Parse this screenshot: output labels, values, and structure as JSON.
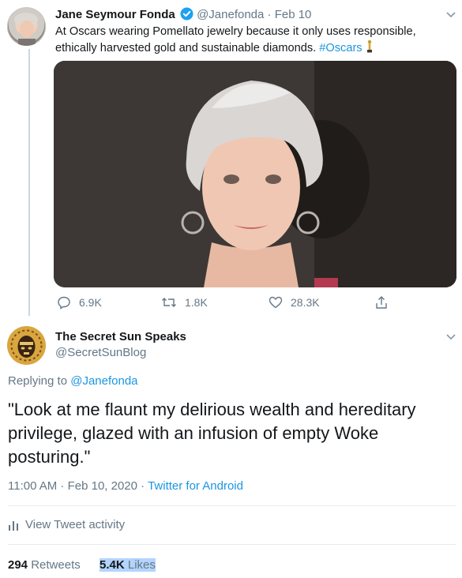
{
  "tweet1": {
    "author_name": "Jane Seymour Fonda",
    "handle": "@Janefonda",
    "sep": "·",
    "date": "Feb 10",
    "text_line1": "At Oscars wearing Pomellato jewelry because it only uses responsible,",
    "text_line2": "ethically harvested gold and sustainable diamonds.",
    "hashtag": "#Oscars",
    "stats": {
      "replies": "6.9K",
      "retweets": "1.8K",
      "likes": "28.3K"
    }
  },
  "tweet2": {
    "author_name": "The Secret Sun Speaks",
    "handle": "@SecretSunBlog",
    "replying_prefix": "Replying to",
    "replying_to": "@Janefonda",
    "text_line1": "\"Look at me flaunt my delirious wealth and hereditary",
    "text_line2": "privilege, glazed with an infusion of empty Woke",
    "text_line3": "posturing.\"",
    "timestamp": "11:00 AM · Feb 10, 2020",
    "dot": "·",
    "source": "Twitter for Android",
    "activity_label": "View Tweet activity",
    "retweets_count": "294",
    "retweets_label": "Retweets",
    "likes_count": "5.4K",
    "likes_label": "Likes"
  },
  "colors": {
    "link": "#1b95e0",
    "muted": "#657786",
    "verified": "#1da1f2",
    "highlight": "#b3d4fc"
  }
}
